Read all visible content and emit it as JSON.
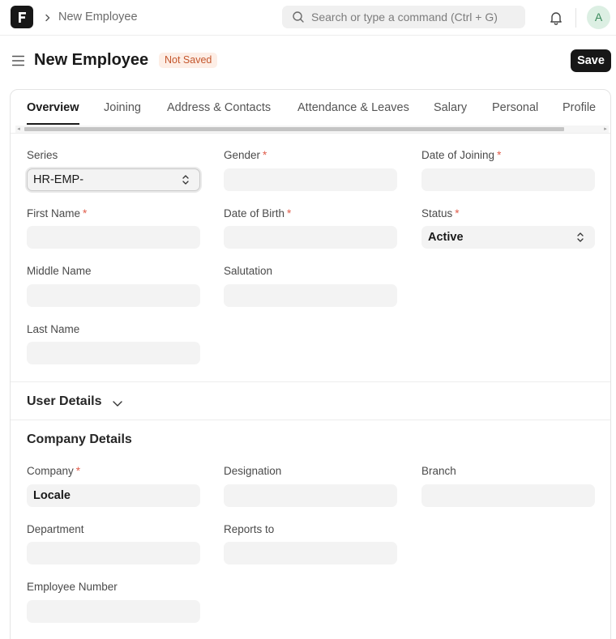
{
  "navbar": {
    "breadcrumb": "New Employee",
    "search_placeholder": "Search or type a command (Ctrl + G)",
    "avatar_initial": "A"
  },
  "page": {
    "title": "New Employee",
    "status_badge": "Not Saved",
    "save_label": "Save"
  },
  "tabs": [
    {
      "label": "Overview",
      "active": true
    },
    {
      "label": "Joining"
    },
    {
      "label": "Address & Contacts"
    },
    {
      "label": "Attendance & Leaves"
    },
    {
      "label": "Salary"
    },
    {
      "label": "Personal"
    },
    {
      "label": "Profile"
    }
  ],
  "overview": {
    "series": {
      "label": "Series",
      "value": "HR-EMP-"
    },
    "gender": {
      "label": "Gender",
      "required": "*"
    },
    "date_of_joining": {
      "label": "Date of Joining",
      "required": "*"
    },
    "first_name": {
      "label": "First Name",
      "required": "*"
    },
    "date_of_birth": {
      "label": "Date of Birth",
      "required": "*"
    },
    "status": {
      "label": "Status",
      "required": "*",
      "value": "Active"
    },
    "middle_name": {
      "label": "Middle Name"
    },
    "salutation": {
      "label": "Salutation"
    },
    "last_name": {
      "label": "Last Name"
    }
  },
  "user_details": {
    "title": "User Details"
  },
  "company_details": {
    "title": "Company Details",
    "company": {
      "label": "Company",
      "required": "*",
      "value": "Locale"
    },
    "designation": {
      "label": "Designation"
    },
    "branch": {
      "label": "Branch"
    },
    "department": {
      "label": "Department"
    },
    "reports_to": {
      "label": "Reports to"
    },
    "employee_number": {
      "label": "Employee Number"
    }
  },
  "colors": {
    "accent": "#171717",
    "badge_bg": "#fdeee6",
    "badge_text": "#c4562c",
    "required": "#e05d4b",
    "field_bg": "#f3f3f3"
  }
}
